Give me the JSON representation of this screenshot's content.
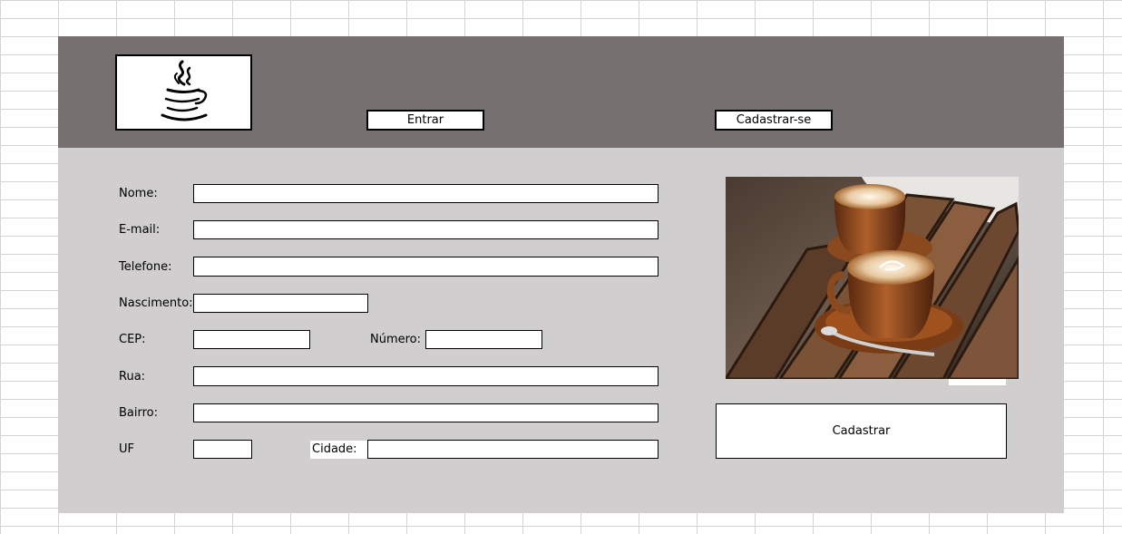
{
  "header": {
    "logo_icon": "java-coffee-cup-icon",
    "entrar_label": "Entrar",
    "cadastrar_se_label": "Cadastrar-se"
  },
  "form": {
    "nome_label": "Nome:",
    "email_label": "E-mail:",
    "telefone_label": "Telefone:",
    "nascimento_label": "Nascimento:",
    "cep_label": "CEP:",
    "numero_label": "Número:",
    "rua_label": "Rua:",
    "bairro_label": "Bairro:",
    "uf_label": "UF",
    "cidade_label": "Cidade:"
  },
  "sidebar": {
    "photo_subject": "two-cappuccino-cups-on-wooden-table",
    "submit_label": "Cadastrar"
  },
  "colors": {
    "header_bg": "#767170",
    "content_bg": "#d0cece",
    "grid_line": "#d4d4d4"
  }
}
